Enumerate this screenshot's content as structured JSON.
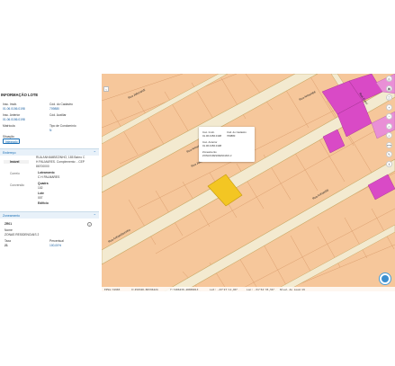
{
  "panel": {
    "title": "INFORMAÇÃO LOTE",
    "fields": [
      {
        "label": "Insc. Imob.",
        "value": "01.06.0156.0198"
      },
      {
        "label": "Cód. do Cadastro",
        "value": "709880"
      },
      {
        "label": "Insc. Anterior",
        "value": "01.06.0156.0198"
      },
      {
        "label": "Cód. Auxiliar",
        "value": ""
      },
      {
        "label": "Matrícula",
        "value": ""
      },
      {
        "label": "Tipo de Condomínio",
        "value": "N"
      },
      {
        "label": "Situação",
        "value": ""
      }
    ],
    "situacao_chip": "Integrado",
    "endereco": {
      "header": "Endereço",
      "tabs": [
        "Imóvel",
        "Correio",
        "Conversão"
      ],
      "address_lines": [
        "RUA ANHAMBEZINHO, 185 Bairro C",
        "H PALMARES. Complemento: - CEP",
        "86700000"
      ],
      "items": [
        {
          "label": "Loteamento",
          "value": "C H PALMARES"
        },
        {
          "label": "Quadra",
          "value": "102"
        },
        {
          "label": "Lote",
          "value": "007"
        },
        {
          "label": "Edifício",
          "value": ""
        }
      ]
    },
    "zoneamento": {
      "header": "Zoneamento",
      "code": "ZR01",
      "nome_label": "Nome",
      "nome_value": "ZONAS RESIDENCIAIS 2",
      "taxa_label": "Taxa",
      "taxa_value": "21",
      "percentual_label": "Percentual",
      "percentual_value": "100,00%"
    }
  },
  "map": {
    "toggle_icon": "chevron-left-icon",
    "streets": [
      "Rua Jaborandi",
      "Rua Anhambezinho",
      "Rua Anhambé",
      "Rua Anhambezinho",
      "Rua Anhambé",
      "Rua Jaborandi",
      "Rua Cuecí"
    ],
    "popup": {
      "insc_label": "Insc. Imob.",
      "insc_value": "01.06.0156.0198",
      "cod_label": "Cód. do Cadastro",
      "cod_value": "709880",
      "ant_label": "Insc. Anterior",
      "ant_value": "01.06.0156.0198",
      "zon_label": "Zoneamento",
      "zon_value": "ZONAS RESIDENCIAIS 2"
    },
    "toolbar_icons": [
      "layers-icon",
      "print-icon",
      "info-icon",
      "zoom-in-icon",
      "zoom-out-icon",
      "home-icon",
      "search-icon",
      "measure-icon",
      "draw-icon",
      "share-icon"
    ],
    "toolbar_glyphs": [
      "◎",
      "▦",
      "ⓘ",
      "+",
      "−",
      "⌂",
      "⌕",
      "⟷",
      "✎",
      "⇪"
    ],
    "status": {
      "epsg": "EPSG:31983",
      "x": "X:450340.88336424",
      "y": "Y:7486230.48009813",
      "lat": "Lat: -23°27'11,80\"",
      "lon": "Lon: -51°52'35,56\"",
      "zoom": "Nível de zoom:19"
    },
    "colors": {
      "background": "#f6c79b",
      "street": "#f2e4b0",
      "highlight_lot": "#f3c623",
      "commercial": "#d94ac6"
    }
  }
}
